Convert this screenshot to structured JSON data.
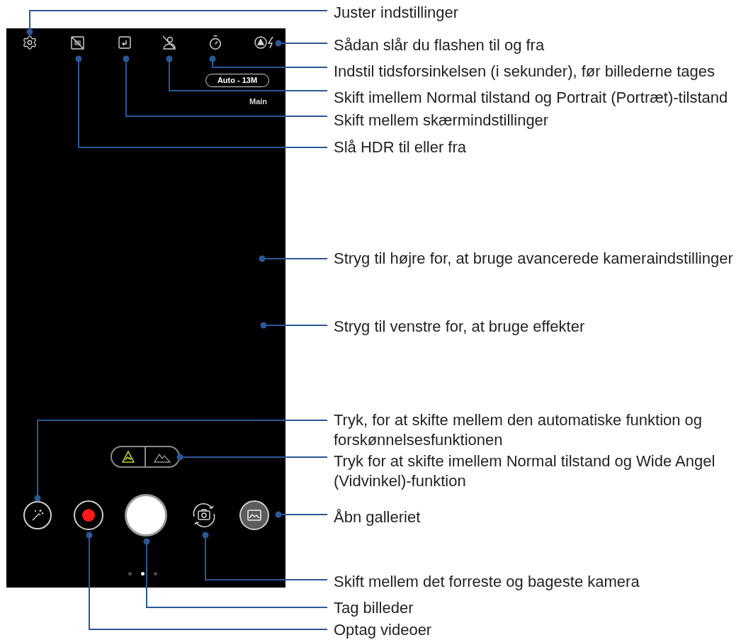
{
  "camera_screen": {
    "resolution_badge": "Auto - 13M",
    "lens_label": "Main",
    "lens_toggle": [
      {
        "selected": true
      },
      {
        "selected": false
      }
    ],
    "page_indicator": [
      {
        "selected": false
      },
      {
        "selected": true
      },
      {
        "selected": false
      }
    ]
  },
  "callouts": [
    {
      "text": "Juster indstillinger"
    },
    {
      "text": "Sådan slår du flashen til og fra"
    },
    {
      "text": "Indstil tidsforsinkelsen (i sekunder), før billederne tages"
    },
    {
      "text": "Skift imellem Normal tilstand og Portrait (Portræt)-tilstand"
    },
    {
      "text": "Skift mellem skærmindstillinger"
    },
    {
      "text": "Slå HDR til eller fra"
    },
    {
      "text": "Stryg til højre for, at bruge avancerede kameraindstillinger"
    },
    {
      "text": "Stryg til venstre for, at bruge effekter"
    },
    {
      "text": "Tryk, for at skifte mellem den automatiske funktion og forskønnelsesfunktionen"
    },
    {
      "text": "Tryk for at skifte imellem Normal tilstand og Wide Angel (Vidvinkel)-funktion"
    },
    {
      "text": "Åbn galleriet"
    },
    {
      "text": "Skift mellem det forreste og bageste kamera"
    },
    {
      "text": "Tag billeder"
    },
    {
      "text": "Optag videoer"
    }
  ]
}
